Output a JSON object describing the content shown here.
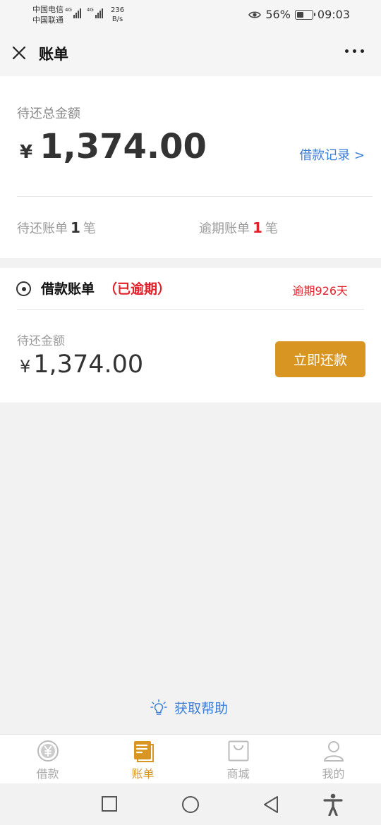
{
  "status_bar": {
    "carrier1": "中国电信",
    "carrier2": "中国联通",
    "net1": "4G",
    "net2": "4G",
    "speed_value": "236",
    "speed_unit": "B/s",
    "battery_percent": "56%",
    "battery_level": 0.56,
    "time": "09:03",
    "icons": [
      "eye-icon",
      "battery-icon"
    ]
  },
  "header": {
    "title": "账单",
    "icons": [
      "close-icon",
      "more-icon"
    ]
  },
  "summary": {
    "label": "待还总金额",
    "currency": "¥",
    "amount": "1,374.00",
    "loan_record_link": "借款记录 >",
    "pending": {
      "prefix": "待还账单",
      "count": "1",
      "suffix": "笔"
    },
    "overdue": {
      "prefix": "逾期账单",
      "count": "1",
      "suffix": "笔"
    }
  },
  "bill": {
    "title": "借款账单",
    "status": "（已逾期）",
    "overdue_days": "逾期926天",
    "amount_label": "待还金额",
    "currency": "¥",
    "amount": "1,374.00",
    "pay_button": "立即还款"
  },
  "help": {
    "label": "获取帮助",
    "icon": "lightbulb-icon"
  },
  "tabs": [
    {
      "label": "借款",
      "icon": "yuan-icon",
      "active": false
    },
    {
      "label": "账单",
      "icon": "bill-icon",
      "active": true
    },
    {
      "label": "商城",
      "icon": "shopping-bag-icon",
      "active": false
    },
    {
      "label": "我的",
      "icon": "profile-icon",
      "active": false
    }
  ],
  "nav": [
    "recents-square-icon",
    "home-circle-icon",
    "back-triangle-icon",
    "accessibility-icon"
  ],
  "colors": {
    "accent": "#d89521",
    "link": "#3b7fd8",
    "alert": "#e3202a",
    "background": "#f2f2f2"
  }
}
